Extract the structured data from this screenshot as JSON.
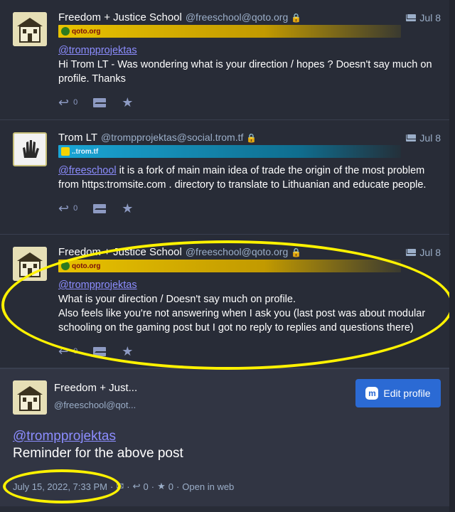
{
  "statuses": [
    {
      "display_name": "Freedom + Justice School",
      "acct": "@freeschool@qoto.org",
      "date": "Jul 8",
      "ticker": "qoto.org",
      "mention": "@trompprojektas",
      "text_lines": [
        "Hi Trom LT - Was wondering what is your direction / hopes ? Doesn't say much on profile. Thanks"
      ],
      "reply_count": "0"
    },
    {
      "display_name": "Trom LT",
      "acct": "@trompprojektas@social.trom.tf",
      "date": "Jul 8",
      "ticker": "..trom.tf",
      "mention": "@freeschool",
      "text": " it is a fork of main main idea of trade the origin of the most problem from https:tromsite.com . directory to translate to Lithuanian and educate people.",
      "reply_count": "0"
    },
    {
      "display_name": "Freedom + Justice School",
      "acct": "@freeschool@qoto.org",
      "date": "Jul 8",
      "ticker": "qoto.org",
      "mention": "@trompprojektas",
      "line1": "What is your direction / Doesn't say much on profile.",
      "line2": "Also feels like you're not answering when I ask you (last post was about modular schooling on the gaming post but I got no reply to replies and questions there)",
      "reply_count": "0"
    }
  ],
  "focused": {
    "display_name": "Freedom + Just...",
    "acct": "@freeschool@qot...",
    "edit_button": "Edit profile",
    "mention": "@trompprojektas",
    "text": "Reminder for the above post",
    "timestamp": "July 15, 2022, 7:33 PM",
    "sep": "·",
    "reply_count": "0",
    "fav_count": "0",
    "open_in_web": "Open in web"
  },
  "colors": {
    "background": "#282c37",
    "focused_background": "#313543",
    "accent": "#2b6ad4",
    "mention": "#8c8dff",
    "annotation": "#fff200"
  }
}
